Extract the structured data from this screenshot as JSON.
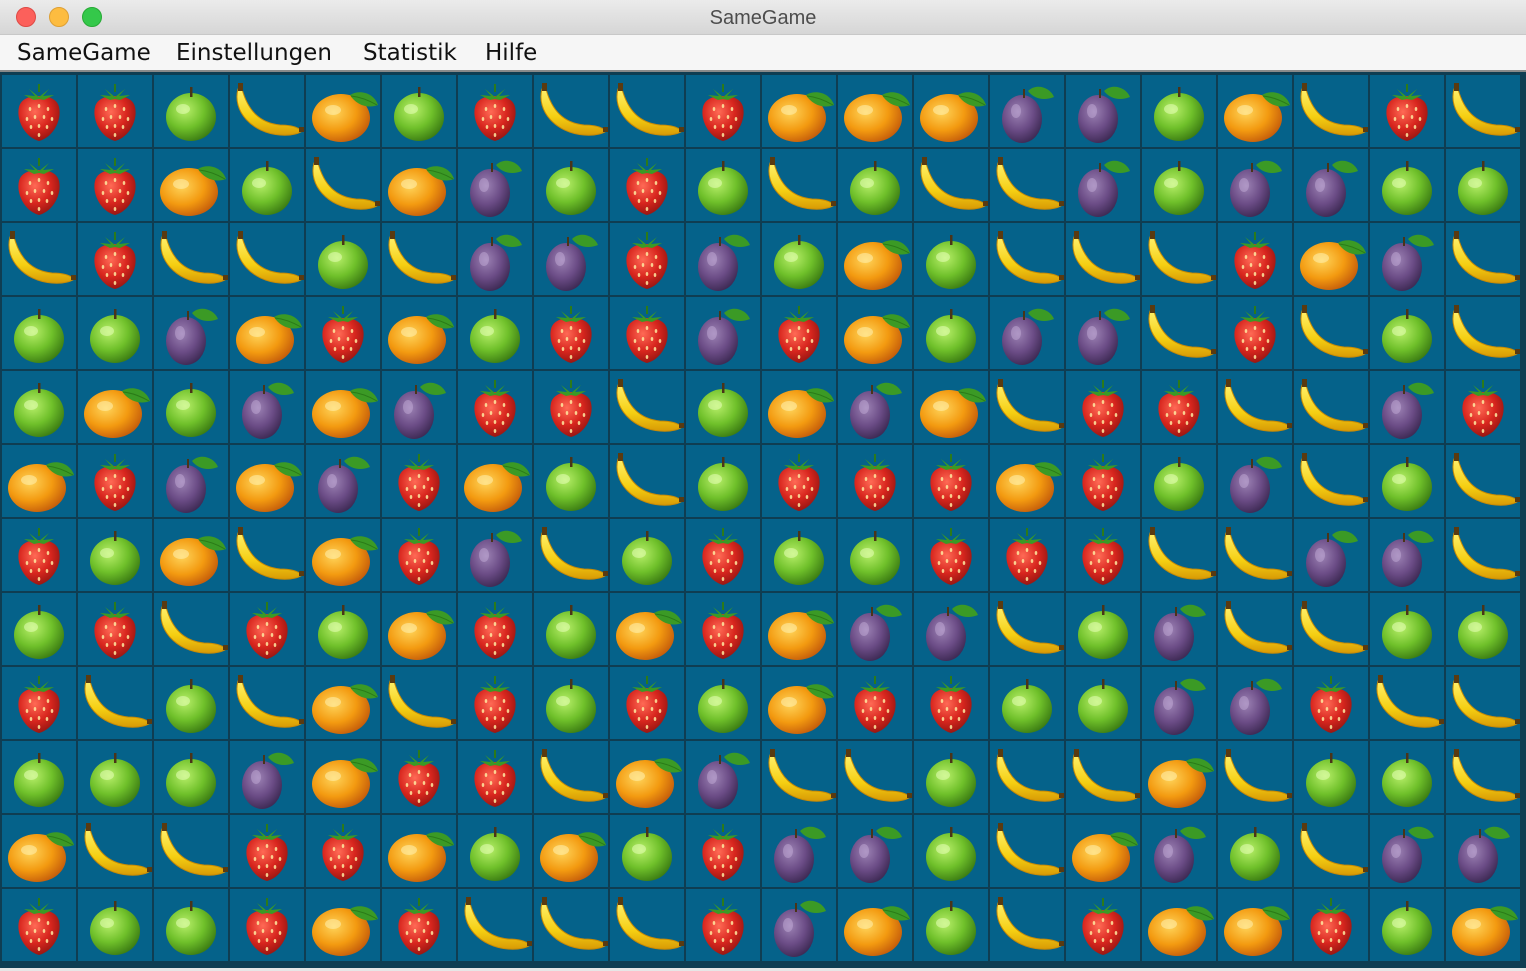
{
  "window": {
    "title": "SameGame"
  },
  "menu": [
    {
      "label": "SameGame",
      "name": "menu-samegame"
    },
    {
      "label": "Einstellungen",
      "name": "menu-einstellungen"
    },
    {
      "label": "Statistik",
      "name": "menu-statistik"
    },
    {
      "label": "Hilfe",
      "name": "menu-hilfe"
    }
  ],
  "legend": {
    "S": "strawberry",
    "A": "apple",
    "B": "banana",
    "O": "orange",
    "P": "plum"
  },
  "colors": {
    "board_background": "#05628a",
    "grid_lines": "#0f3d52",
    "strawberry": "#d8261e",
    "apple": "#6fc02a",
    "banana": "#f5cf12",
    "orange": "#f39a10",
    "plum": "#6b4c86",
    "leaf": "#3b9a25"
  },
  "board": {
    "columns": 20,
    "rows": 12,
    "grid": [
      [
        "S",
        "S",
        "A",
        "B",
        "O",
        "A",
        "S",
        "B",
        "B",
        "S",
        "O",
        "O",
        "O",
        "P",
        "P",
        "A",
        "O",
        "B",
        "S",
        "B"
      ],
      [
        "S",
        "S",
        "O",
        "A",
        "B",
        "O",
        "P",
        "A",
        "S",
        "A",
        "B",
        "A",
        "B",
        "B",
        "P",
        "A",
        "P",
        "P",
        "A",
        "A"
      ],
      [
        "B",
        "S",
        "B",
        "B",
        "A",
        "B",
        "P",
        "P",
        "S",
        "P",
        "A",
        "O",
        "A",
        "B",
        "B",
        "B",
        "S",
        "O",
        "P",
        "B"
      ],
      [
        "A",
        "A",
        "P",
        "O",
        "S",
        "O",
        "A",
        "S",
        "S",
        "P",
        "S",
        "O",
        "A",
        "P",
        "P",
        "B",
        "S",
        "B",
        "A",
        "B"
      ],
      [
        "A",
        "O",
        "A",
        "P",
        "O",
        "P",
        "S",
        "S",
        "B",
        "A",
        "O",
        "P",
        "O",
        "B",
        "S",
        "S",
        "B",
        "B",
        "P",
        "S"
      ],
      [
        "O",
        "S",
        "P",
        "O",
        "P",
        "S",
        "O",
        "A",
        "B",
        "A",
        "S",
        "S",
        "S",
        "O",
        "S",
        "A",
        "P",
        "B",
        "A",
        "B"
      ],
      [
        "S",
        "A",
        "O",
        "B",
        "O",
        "S",
        "P",
        "B",
        "A",
        "S",
        "A",
        "A",
        "S",
        "S",
        "S",
        "B",
        "B",
        "P",
        "P",
        "B"
      ],
      [
        "A",
        "S",
        "B",
        "S",
        "A",
        "O",
        "S",
        "A",
        "O",
        "S",
        "O",
        "P",
        "P",
        "B",
        "A",
        "P",
        "B",
        "B",
        "A",
        "A"
      ],
      [
        "S",
        "B",
        "A",
        "B",
        "O",
        "B",
        "S",
        "A",
        "S",
        "A",
        "O",
        "S",
        "S",
        "A",
        "A",
        "P",
        "P",
        "S",
        "B",
        "B"
      ],
      [
        "A",
        "A",
        "A",
        "P",
        "O",
        "S",
        "S",
        "B",
        "O",
        "P",
        "B",
        "B",
        "A",
        "B",
        "B",
        "O",
        "B",
        "A",
        "A",
        "B"
      ],
      [
        "O",
        "B",
        "B",
        "S",
        "S",
        "O",
        "A",
        "O",
        "A",
        "S",
        "P",
        "P",
        "A",
        "B",
        "O",
        "P",
        "A",
        "B",
        "P",
        "P"
      ],
      [
        "S",
        "A",
        "A",
        "S",
        "O",
        "S",
        "B",
        "B",
        "B",
        "S",
        "P",
        "O",
        "A",
        "B",
        "S",
        "O",
        "O",
        "S",
        "A",
        "O"
      ]
    ]
  }
}
